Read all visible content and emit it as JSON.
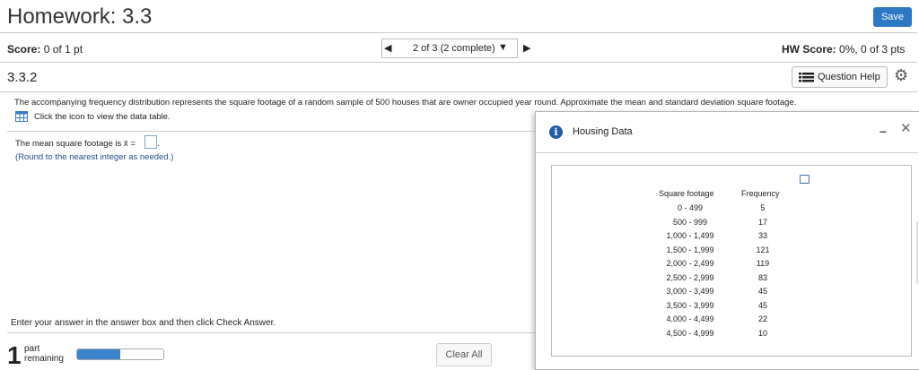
{
  "header": {
    "title": "Homework: 3.3",
    "save_label": "Save"
  },
  "score": {
    "label": "Score:",
    "value": "0 of 1 pt"
  },
  "nav": {
    "position": "2 of 3 (2 complete)"
  },
  "hw_score": {
    "label": "HW Score:",
    "value": "0%, 0 of 3 pts"
  },
  "question": {
    "number": "3.3.2",
    "help_label": "Question Help",
    "prompt": "The accompanying frequency distribution represents the square footage of a random sample of 500 houses that are owner occupied year round. Approximate the mean and standard deviation square footage.",
    "table_link": "Click the icon to view the data table.",
    "mean_prefix": "The mean square footage is x̄ =",
    "mean_suffix": ".",
    "round_note": "(Round to the nearest integer as needed.)",
    "instructions": "Enter your answer in the answer box and then click Check Answer."
  },
  "footer": {
    "parts_count": "1",
    "parts_text_1": "part",
    "parts_text_2": "remaining",
    "progress_fraction": 0.5,
    "clear_label": "Clear All"
  },
  "modal": {
    "title": "Housing Data",
    "headers": [
      "Square footage",
      "Frequency"
    ],
    "rows": [
      [
        "0 - 499",
        "5"
      ],
      [
        "500 - 999",
        "17"
      ],
      [
        "1,000 - 1,499",
        "33"
      ],
      [
        "1,500 - 1,999",
        "121"
      ],
      [
        "2,000 - 2,499",
        "119"
      ],
      [
        "2,500 - 2,999",
        "83"
      ],
      [
        "3,000 - 3,499",
        "45"
      ],
      [
        "3,500 - 3,999",
        "45"
      ],
      [
        "4,000 - 4,499",
        "22"
      ],
      [
        "4,500 - 4,999",
        "10"
      ]
    ]
  },
  "colors": {
    "accent": "#2b78c5",
    "info": "#1f5fa8"
  }
}
